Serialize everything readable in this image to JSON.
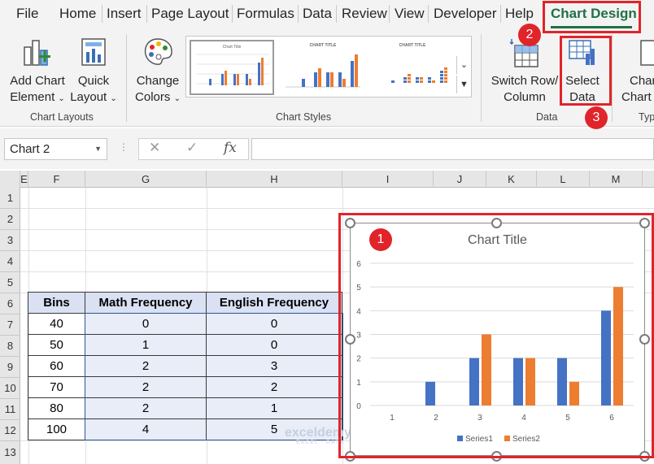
{
  "ribbon_tabs": [
    {
      "label": "File"
    },
    {
      "label": "Home"
    },
    {
      "label": "Insert"
    },
    {
      "label": "Page Layout"
    },
    {
      "label": "Formulas"
    },
    {
      "label": "Data"
    },
    {
      "label": "Review"
    },
    {
      "label": "View"
    },
    {
      "label": "Developer"
    },
    {
      "label": "Help"
    }
  ],
  "active_tab": {
    "label": "Chart Design",
    "color": "#1e7145"
  },
  "ribbon": {
    "add_chart_element": {
      "line1": "Add Chart",
      "line2": "Element",
      "icon": "add-chart-element-icon"
    },
    "quick_layout": {
      "line1": "Quick",
      "line2": "Layout",
      "icon": "quick-layout-icon"
    },
    "chart_layouts_group": "Chart Layouts",
    "change_colors": {
      "line1": "Change",
      "line2": "Colors",
      "icon": "palette-icon"
    },
    "chart_styles_group": "Chart Styles",
    "switch_row_column": {
      "line1": "Switch Row/",
      "line2": "Column",
      "icon": "switch-row-column-icon"
    },
    "select_data": {
      "line1": "Select",
      "line2": "Data",
      "icon": "select-data-icon"
    },
    "data_group": "Data",
    "change_chart_type": {
      "line1": "Char",
      "line2": "Chart T"
    },
    "type_group": "Typ",
    "gallery_thumbs": [
      {
        "title": "Chart Title",
        "selected": true
      },
      {
        "title": "CHART TITLE",
        "selected": false
      },
      {
        "title": "CHART TITLE",
        "selected": false
      }
    ]
  },
  "formula_bar": {
    "name_box": "Chart 2",
    "cancel_icon": "✕",
    "enter_icon": "✓",
    "fx_icon": "fx",
    "formula": ""
  },
  "grid": {
    "columns": [
      "E",
      "F",
      "G",
      "H",
      "I",
      "J",
      "K",
      "L",
      "M"
    ],
    "rows": [
      "1",
      "2",
      "3",
      "4",
      "5",
      "6",
      "7",
      "8",
      "9",
      "10",
      "11",
      "12",
      "13"
    ]
  },
  "table": {
    "headers": [
      "Bins",
      "Math Frequency",
      "English Frequency"
    ],
    "rows": [
      [
        "40",
        "0",
        "0"
      ],
      [
        "50",
        "1",
        "0"
      ],
      [
        "60",
        "2",
        "3"
      ],
      [
        "70",
        "2",
        "2"
      ],
      [
        "80",
        "2",
        "1"
      ],
      [
        "100",
        "4",
        "5"
      ]
    ]
  },
  "chart_data": {
    "type": "bar",
    "title": "Chart Title",
    "categories": [
      "1",
      "2",
      "3",
      "4",
      "5",
      "6"
    ],
    "series": [
      {
        "name": "Series1",
        "color": "#4472c4",
        "values": [
          0,
          1,
          2,
          2,
          2,
          4
        ]
      },
      {
        "name": "Series2",
        "color": "#ed7d31",
        "values": [
          0,
          0,
          3,
          2,
          1,
          5
        ]
      }
    ],
    "ylim": [
      0,
      6
    ],
    "yticks": [
      "0",
      "1",
      "2",
      "3",
      "4",
      "5",
      "6"
    ],
    "grid": true,
    "legend": "bottom"
  },
  "annotations": {
    "badge1": "1",
    "badge2": "2",
    "badge3": "3",
    "color": "#e0242a"
  },
  "watermark": {
    "brand": "exceldemy",
    "tagline": "EXCEL · DATA · BI"
  }
}
